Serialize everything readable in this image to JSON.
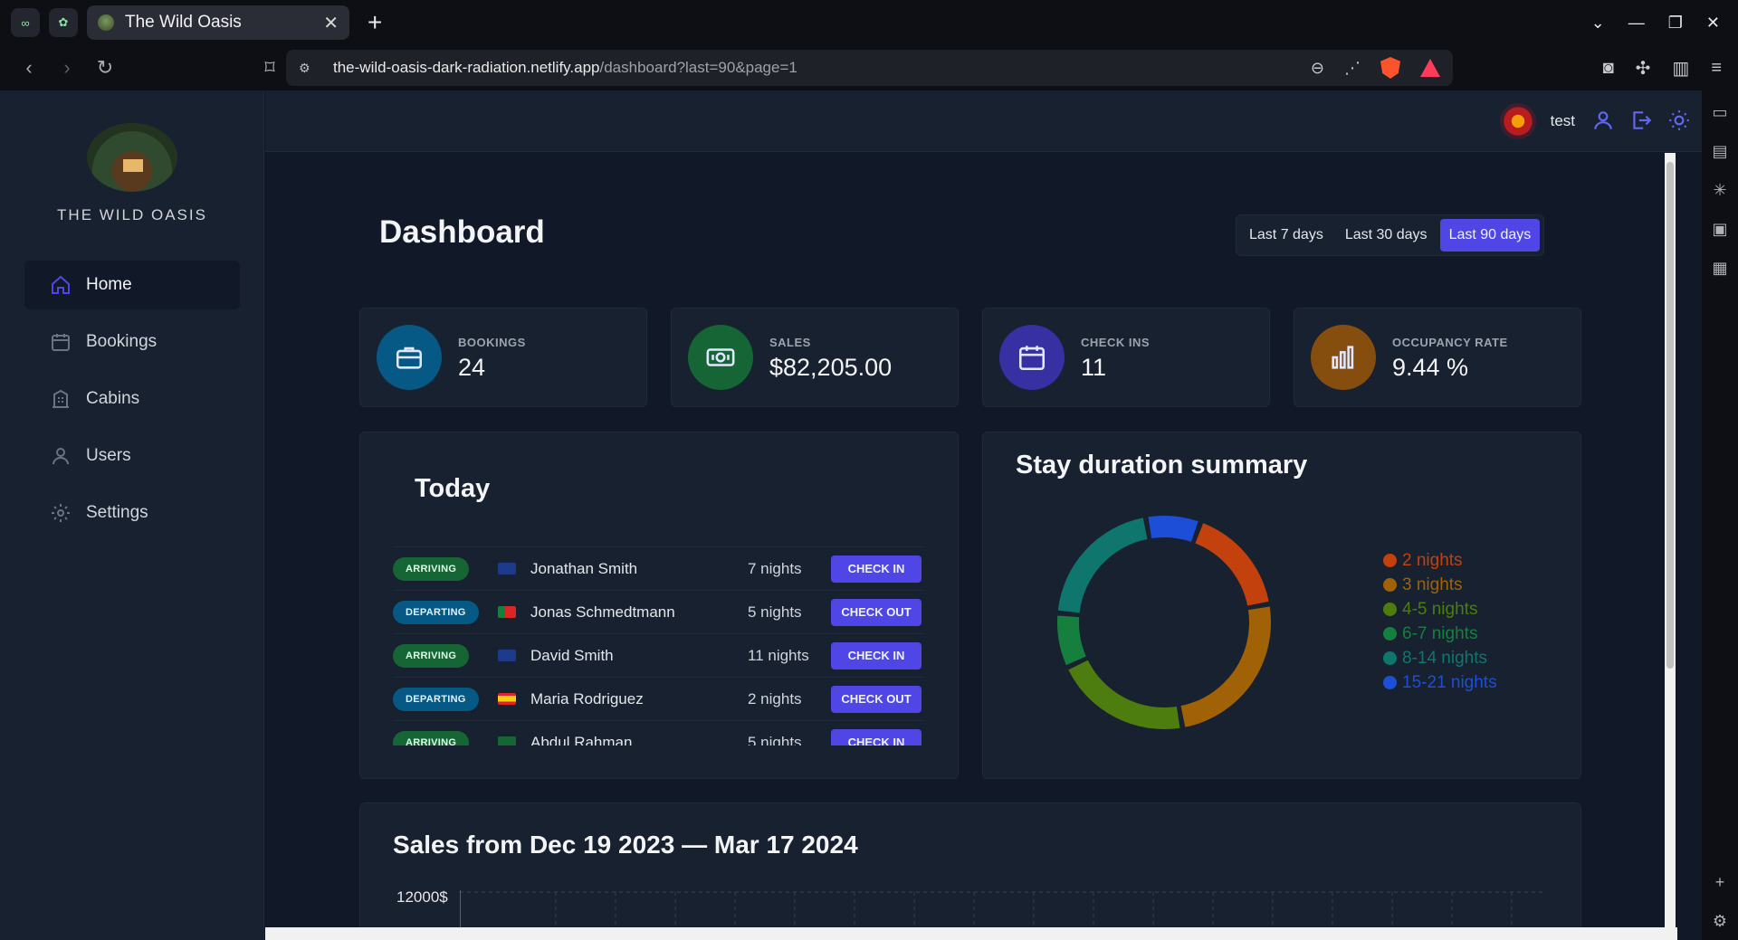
{
  "browser": {
    "tab_title": "The Wild Oasis",
    "url_host": "the-wild-oasis-dark-radiation.netlify.app",
    "url_path": "/dashboard?last=90&page=1"
  },
  "sidebar": {
    "brand": "THE WILD OASIS",
    "items": [
      {
        "label": "Home",
        "icon": "home-icon",
        "active": true
      },
      {
        "label": "Bookings",
        "icon": "calendar-icon",
        "active": false
      },
      {
        "label": "Cabins",
        "icon": "building-icon",
        "active": false
      },
      {
        "label": "Users",
        "icon": "user-icon",
        "active": false
      },
      {
        "label": "Settings",
        "icon": "gear-icon",
        "active": false
      }
    ]
  },
  "header": {
    "username": "test"
  },
  "dashboard": {
    "title": "Dashboard",
    "filters": [
      {
        "label": "Last 7 days",
        "active": false
      },
      {
        "label": "Last 30 days",
        "active": false
      },
      {
        "label": "Last 90 days",
        "active": true
      }
    ],
    "stats": [
      {
        "label": "BOOKINGS",
        "value": "24",
        "color": "#075985",
        "icon": "briefcase-icon"
      },
      {
        "label": "SALES",
        "value": "$82,205.00",
        "color": "#166534",
        "icon": "banknote-icon"
      },
      {
        "label": "CHECK INS",
        "value": "11",
        "color": "#3730a3",
        "icon": "calendar-days-icon"
      },
      {
        "label": "OCCUPANCY RATE",
        "value": "9.44 %",
        "color": "#854d0e",
        "icon": "bar-chart-icon"
      }
    ]
  },
  "today": {
    "title": "Today",
    "rows": [
      {
        "status": "ARRIVING",
        "kind": "arriving",
        "flag": "uk-flag-icon",
        "guest": "Jonathan Smith",
        "nights": "7 nights",
        "action": "CHECK IN"
      },
      {
        "status": "DEPARTING",
        "kind": "departing",
        "flag": "portugal-flag-icon",
        "guest": "Jonas Schmedtmann",
        "nights": "5 nights",
        "action": "CHECK OUT"
      },
      {
        "status": "ARRIVING",
        "kind": "arriving",
        "flag": "australia-flag-icon",
        "guest": "David Smith",
        "nights": "11 nights",
        "action": "CHECK IN"
      },
      {
        "status": "DEPARTING",
        "kind": "departing",
        "flag": "spain-flag-icon",
        "guest": "Maria Rodriguez",
        "nights": "2 nights",
        "action": "CHECK OUT"
      },
      {
        "status": "ARRIVING",
        "kind": "arriving",
        "flag": "saudi-flag-icon",
        "guest": "Abdul Rahman",
        "nights": "5 nights",
        "action": "CHECK IN"
      }
    ]
  },
  "stay": {
    "title": "Stay duration summary"
  },
  "chart_data": {
    "type": "pie",
    "title": "Stay duration summary",
    "categories": [
      "2 nights",
      "3 nights",
      "4-5 nights",
      "6-7 nights",
      "8-14 nights",
      "15-21 nights"
    ],
    "values": [
      4,
      6,
      5,
      2,
      5,
      2
    ],
    "colors": [
      "#c2410c",
      "#a16207",
      "#4d7c0f",
      "#15803d",
      "#0f766e",
      "#1d4ed8"
    ],
    "legend": "right"
  },
  "sales": {
    "title": "Sales from Dec 19 2023 — Mar 17 2024",
    "y_top_label": "12000$"
  }
}
